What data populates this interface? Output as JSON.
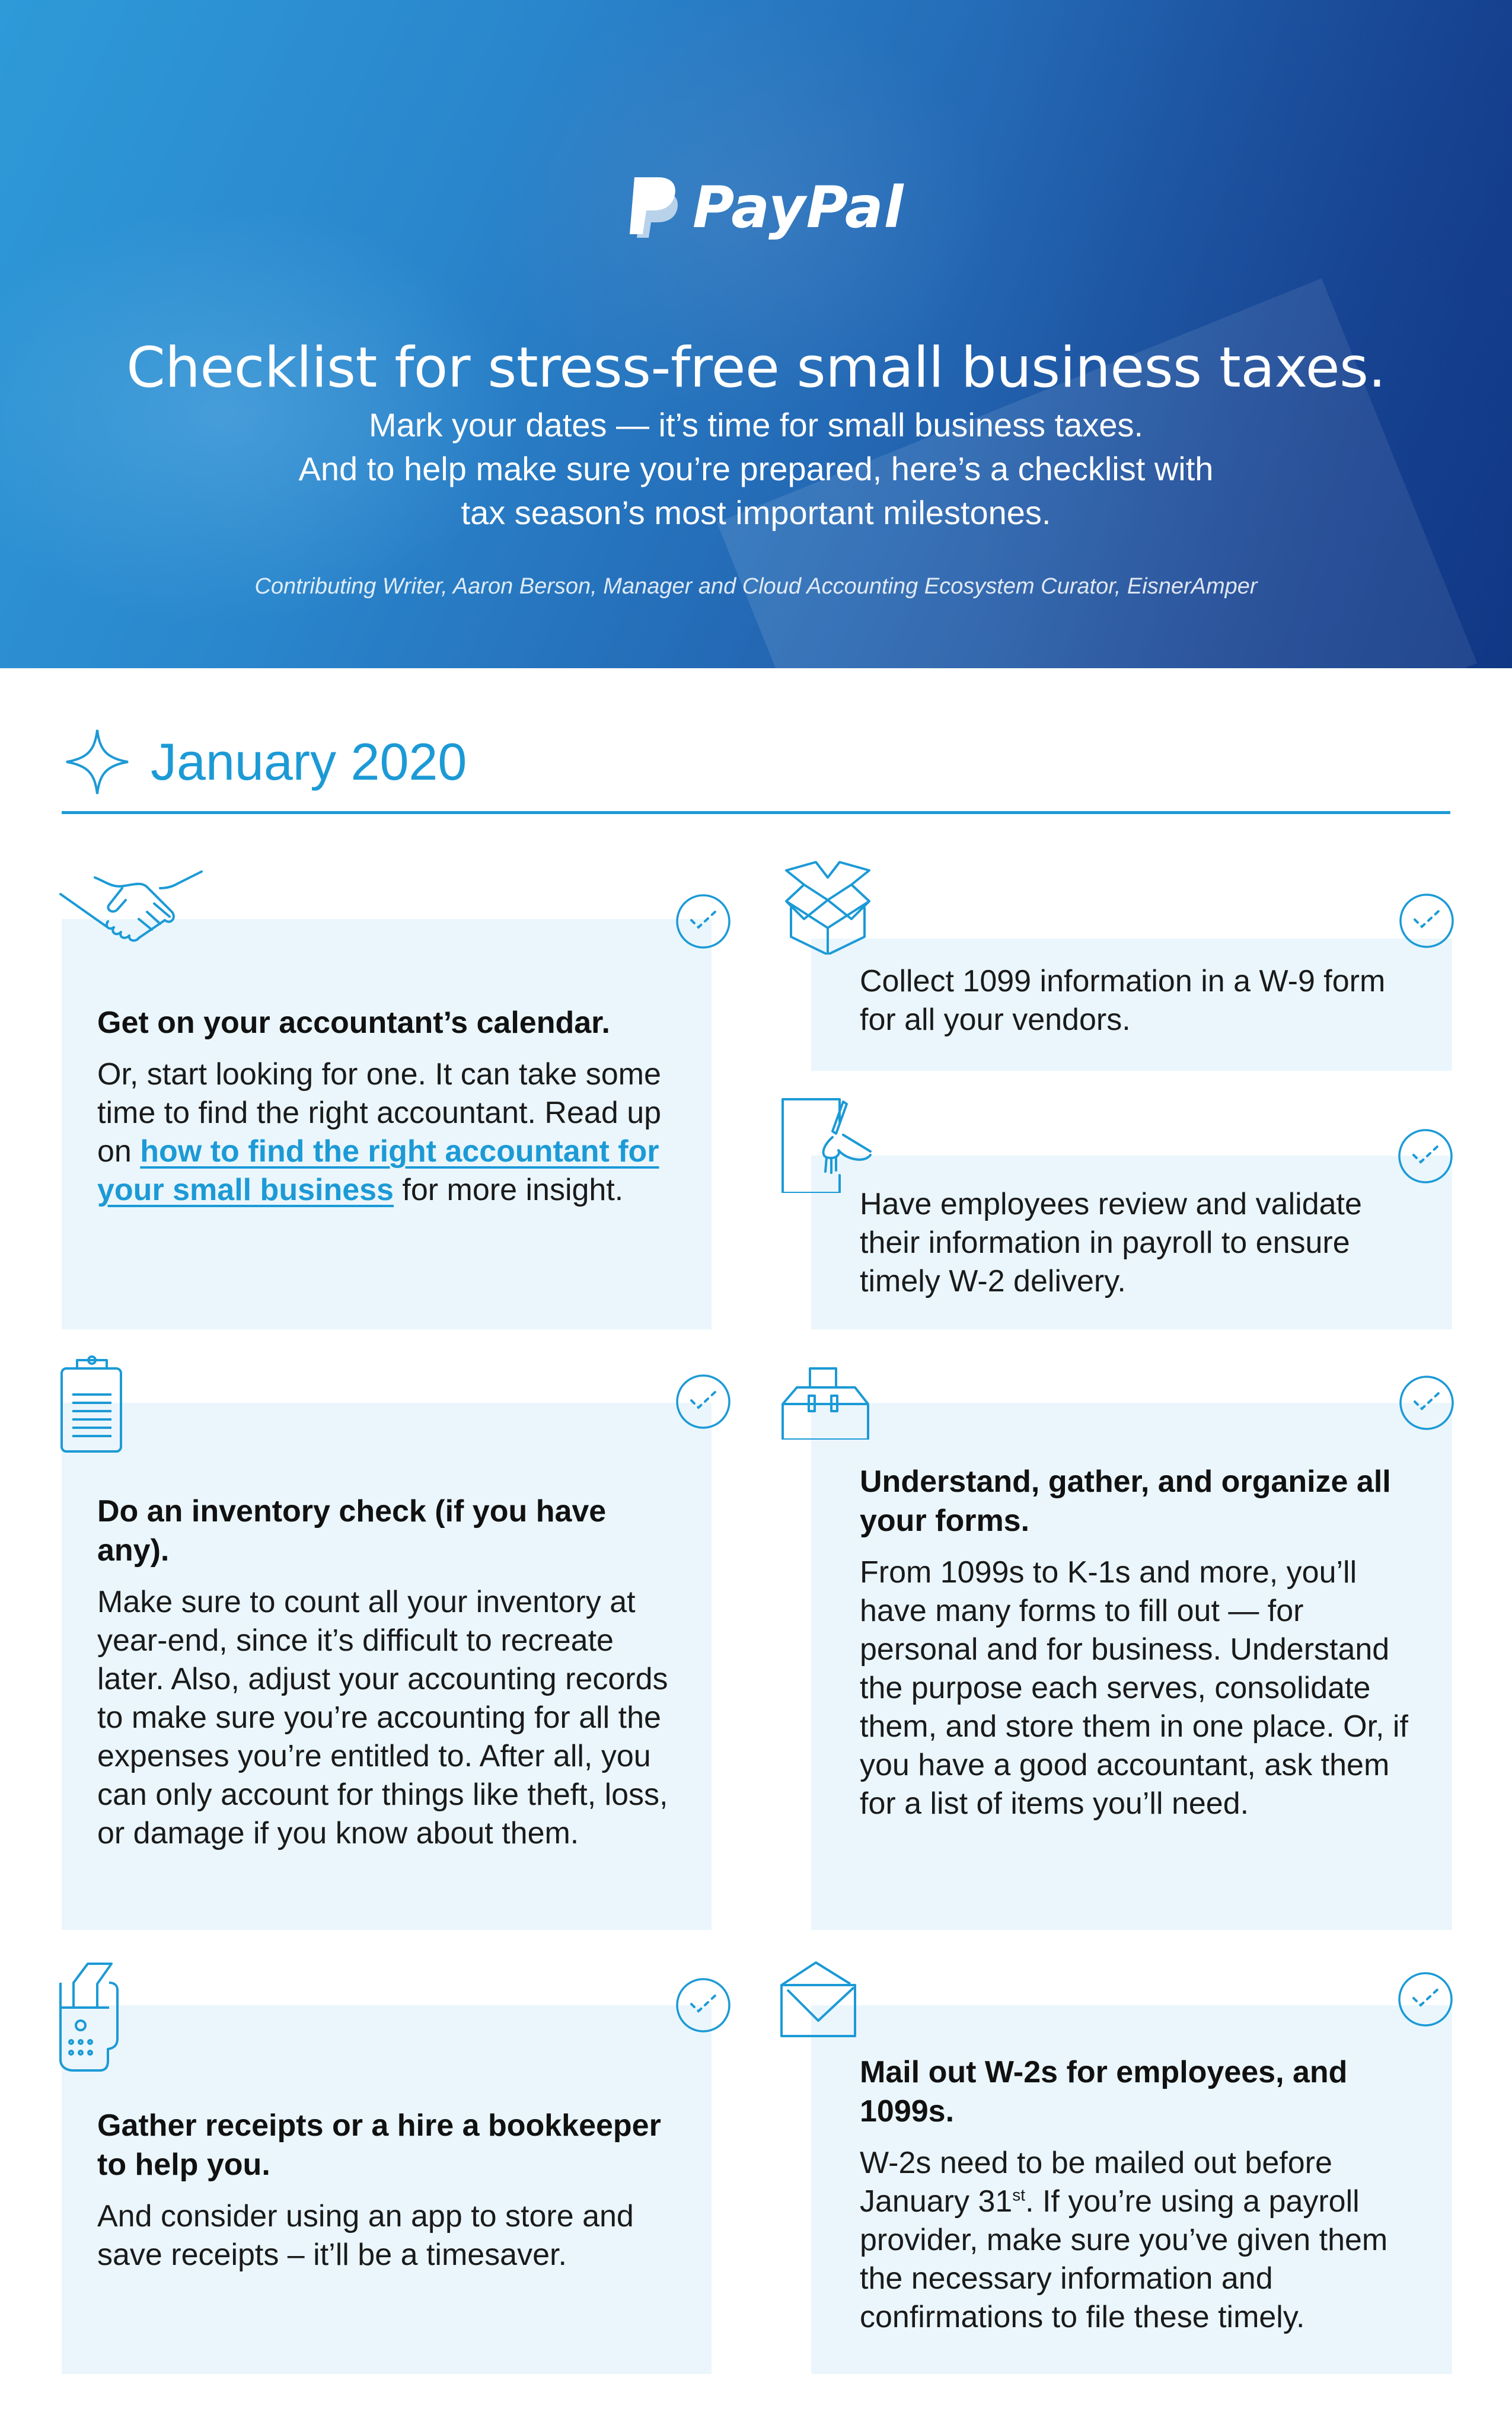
{
  "hero": {
    "brand": "PayPal",
    "title": "Checklist for stress-free small business taxes.",
    "subtitle_lines": [
      "Mark your dates — it’s time for small business taxes.",
      "And to help make sure you’re prepared, here’s a checklist with",
      "tax season’s most important milestones."
    ],
    "credit": "Contributing Writer, Aaron Berson, Manager and Cloud Accounting Ecosystem Curator, EisnerAmper"
  },
  "section": {
    "title": "January 2020",
    "icon": "sparkle-icon"
  },
  "colors": {
    "accent": "#1c9ad6",
    "card_bg": "#eaf6fc",
    "hero_start": "#2e9ad8",
    "hero_end": "#123c88"
  },
  "cards": [
    {
      "icon": "handshake-icon",
      "title": "Get on your accountant’s calendar.",
      "body_before_link": "Or, start looking for one. It can take some time to find the right accountant. Read up on ",
      "link_text": "how to find the right accountant for your small business",
      "body_after_link": " for more insight.",
      "checked": false
    },
    {
      "icon": "open-box-icon",
      "title": "",
      "body": "Collect 1099 information in a W-9 form for all your vendors.",
      "checked": false
    },
    {
      "icon": "signing-document-icon",
      "title": "",
      "body": "Have employees review and validate their information in payroll to ensure timely W-2 delivery.",
      "checked": false
    },
    {
      "icon": "clipboard-icon",
      "title": "Do an inventory check (if you have any).",
      "body": "Make sure to count all your inventory at year-end, since it’s difficult to recreate later. Also, adjust your accounting records to make sure you’re accounting for all the expenses you’re entitled to. After all, you can only account for things like theft, loss, or damage if you know about them.",
      "checked": false
    },
    {
      "icon": "toolbox-icon",
      "title": "Understand, gather, and organize all your forms.",
      "body": "From 1099s to K-1s and more, you’ll have many forms to fill out — for personal and for business. Understand the purpose each serves, consolidate them, and store them in one place. Or, if you have a good accountant, ask them for a list of items you’ll need.",
      "checked": false
    },
    {
      "icon": "receipt-terminal-icon",
      "title": "Gather receipts or a hire a bookkeeper to help you.",
      "body": "And consider using an app to store and save receipts – it’ll be a timesaver.",
      "checked": false
    },
    {
      "icon": "envelope-icon",
      "title": "Mail out W-2s for employees, and 1099s.",
      "body_before_sup": "W-2s need to be mailed out before January 31",
      "sup": "st",
      "body_after_sup": ". If you’re using a payroll provider, make sure you’ve given them the necessary information and confirmations to file these timely.",
      "checked": false
    }
  ]
}
